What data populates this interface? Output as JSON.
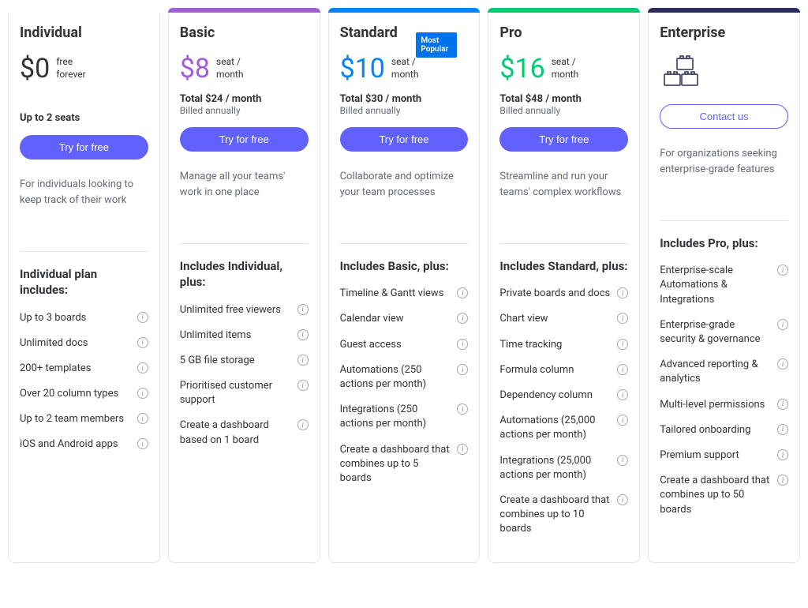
{
  "plans": [
    {
      "id": "individual",
      "name": "Individual",
      "accent": "#ffffff",
      "price": "$0",
      "price_color": "#333338",
      "price_sub": "free forever",
      "seats": "Up to 2 seats",
      "cta": "Try for free",
      "cta_style": "filled",
      "desc": "For individuals looking to keep track of their work",
      "includes_heading": "Individual plan includes:",
      "features": [
        "Up to 3 boards",
        "Unlimited docs",
        "200+ templates",
        "Over 20 column types",
        "Up to 2 team members",
        "iOS and Android apps"
      ]
    },
    {
      "id": "basic",
      "name": "Basic",
      "accent": "#a25ddc",
      "price": "$8",
      "price_color": "#a25ddc",
      "price_sub": "seat / month",
      "total": "Total $24 / month",
      "billed": "Billed annually",
      "cta": "Try for free",
      "cta_style": "filled",
      "desc": "Manage all your teams' work in one place",
      "includes_heading": "Includes Individual, plus:",
      "features": [
        "Unlimited free viewers",
        "Unlimited items",
        "5 GB file storage",
        "Prioritised customer support",
        "Create a dashboard based on 1 board"
      ]
    },
    {
      "id": "standard",
      "name": "Standard",
      "accent": "#0085ff",
      "badge": "Most Popular",
      "price": "$10",
      "price_color": "#0085ff",
      "price_sub": "seat / month",
      "total": "Total $30 / month",
      "billed": "Billed annually",
      "cta": "Try for free",
      "cta_style": "filled",
      "desc": "Collaborate and optimize your team processes",
      "includes_heading": "Includes Basic, plus:",
      "features": [
        "Timeline & Gantt views",
        "Calendar view",
        "Guest access",
        "Automations (250 actions per month)",
        "Integrations (250 actions per month)",
        "Create a dashboard that combines up to 5 boards"
      ]
    },
    {
      "id": "pro",
      "name": "Pro",
      "accent": "#00ca72",
      "price": "$16",
      "price_color": "#00ca72",
      "price_sub": "seat / month",
      "total": "Total $48 / month",
      "billed": "Billed annually",
      "cta": "Try for free",
      "cta_style": "filled",
      "desc": "Streamline and run your teams' complex workflows",
      "includes_heading": "Includes Standard, plus:",
      "features": [
        "Private boards and docs",
        "Chart view",
        "Time tracking",
        "Formula column",
        "Dependency column",
        "Automations (25,000 actions per month)",
        "Integrations (25,000 actions per month)",
        "Create a dashboard that combines up to 10 boards"
      ]
    },
    {
      "id": "enterprise",
      "name": "Enterprise",
      "accent": "#2b2c5d",
      "icon": "blocks",
      "cta": "Contact us",
      "cta_style": "outline",
      "desc": "For organizations seeking enterprise-grade features",
      "includes_heading": "Includes Pro, plus:",
      "features": [
        "Enterprise-scale Automations & Integrations",
        "Enterprise-grade security & governance",
        "Advanced reporting & analytics",
        "Multi-level permissions",
        "Tailored onboarding",
        "Premium support",
        "Create a dashboard that combines up to 50 boards"
      ]
    }
  ]
}
